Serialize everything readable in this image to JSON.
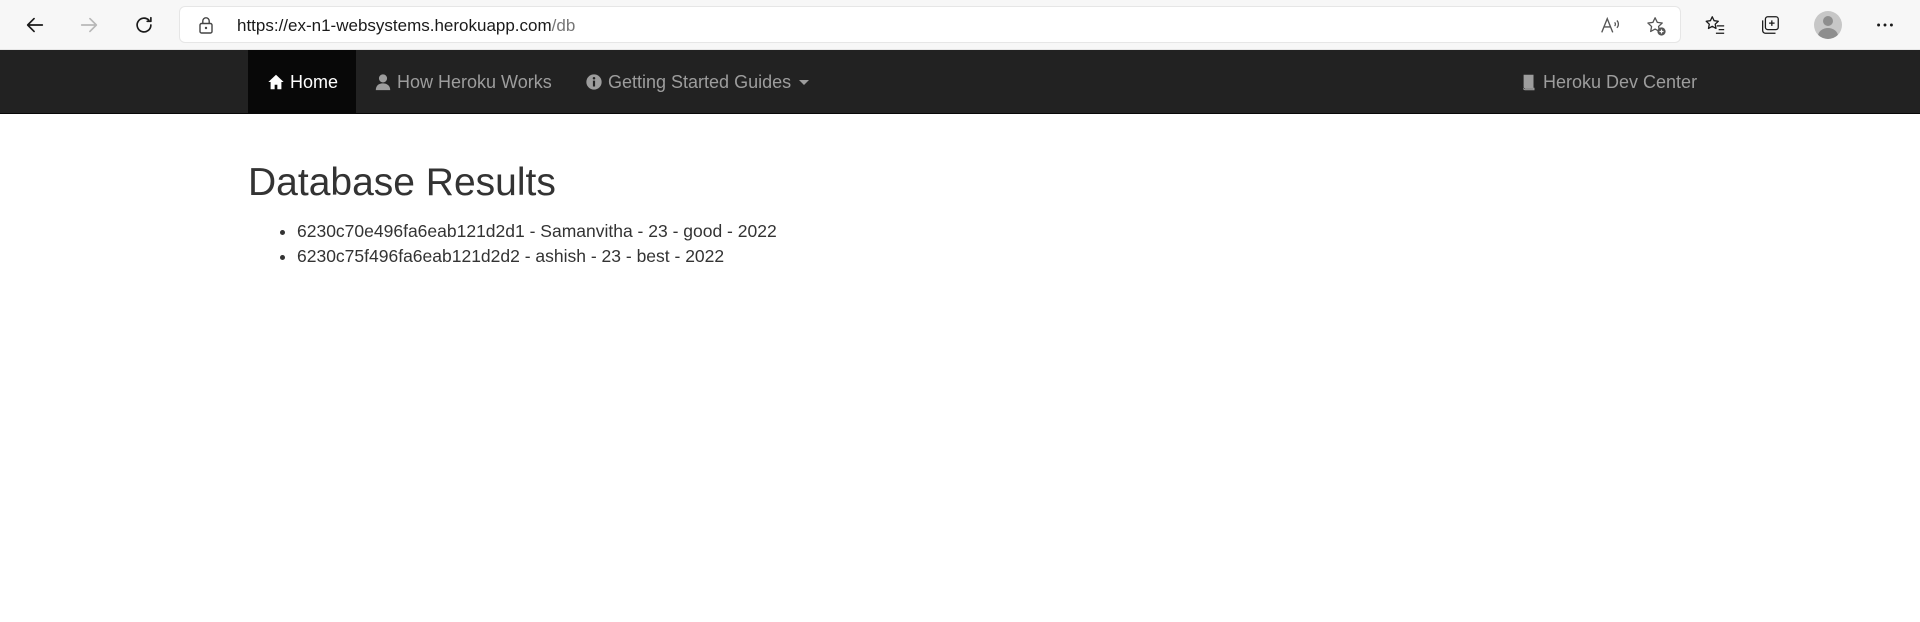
{
  "browser": {
    "url_main": "https://ex-n1-websystems.herokuapp.com",
    "url_path": "/db",
    "icons": [
      "back-arrow-icon",
      "forward-arrow-icon",
      "refresh-icon",
      "lock-icon",
      "read-aloud-icon",
      "add-favorite-icon",
      "favorites-icon",
      "collections-icon",
      "profile-avatar-icon",
      "more-menu-icon"
    ]
  },
  "navbar": {
    "home_label": "Home",
    "how_label": "How Heroku Works",
    "guides_label": "Getting Started Guides",
    "devcenter_label": "Heroku Dev Center",
    "colors": {
      "background": "#222222",
      "active": "#080808",
      "text": "#9d9d9d",
      "active_text": "#ffffff"
    }
  },
  "main": {
    "title": "Database Results",
    "results": [
      "6230c70e496fa6eab121d2d1 - Samanvitha - 23 - good - 2022",
      "6230c75f496fa6eab121d2d2 - ashish - 23 - best - 2022"
    ]
  }
}
